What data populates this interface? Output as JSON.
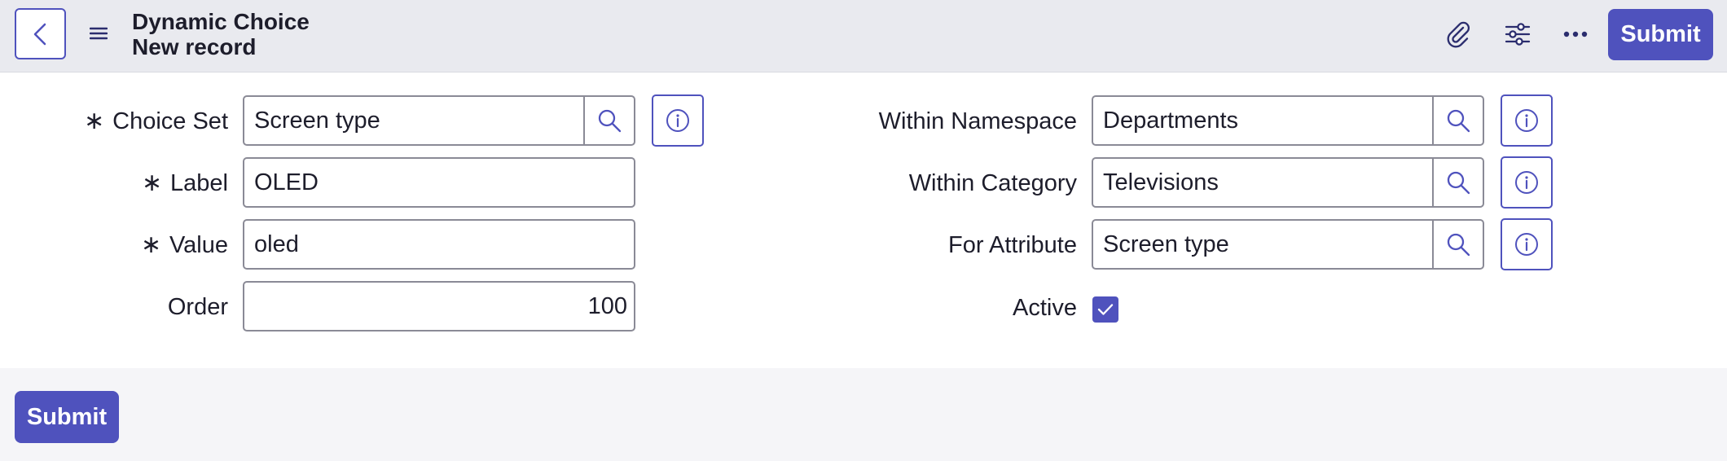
{
  "header": {
    "title": "Dynamic Choice",
    "subtitle": "New record",
    "submit_label": "Submit",
    "icons": [
      "chevron-left-icon",
      "hamburger-menu-icon",
      "paperclip-icon",
      "sliders-icon",
      "more-icon"
    ]
  },
  "form": {
    "left": {
      "choice_set": {
        "label": "Choice Set",
        "value": "Screen type",
        "required": true
      },
      "label": {
        "label": "Label",
        "value": "OLED",
        "required": true
      },
      "value": {
        "label": "Value",
        "value": "oled",
        "required": true
      },
      "order": {
        "label": "Order",
        "value": "100"
      }
    },
    "right": {
      "within_namespace": {
        "label": "Within Namespace",
        "value": "Departments"
      },
      "within_category": {
        "label": "Within Category",
        "value": "Televisions"
      },
      "for_attribute": {
        "label": "For Attribute",
        "value": "Screen type"
      },
      "active": {
        "label": "Active",
        "checked": true
      }
    },
    "required_marker": "∗"
  },
  "footer": {
    "submit_label": "Submit"
  },
  "colors": {
    "accent": "#4f52bd",
    "header_bg": "#e9eaef",
    "page_bg": "#f5f5f8"
  }
}
